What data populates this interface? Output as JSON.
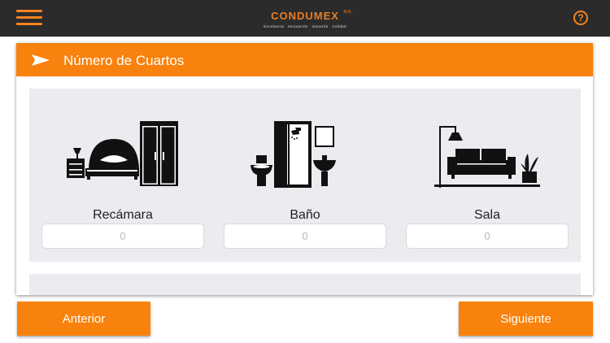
{
  "header": {
    "logo_title": "CONDUMEX",
    "logo_mark": "M.R.",
    "logo_tagline": "Excelencia · Innovación · Garantía · Calidad",
    "help_symbol": "?",
    "menu_icon": "hamburger-menu-icon",
    "help_icon": "question-circle-icon"
  },
  "card": {
    "title": "Número de Cuartos",
    "header_icon": "arrow-right-icon"
  },
  "rooms": [
    {
      "label": "Recámara",
      "placeholder": "0",
      "icon": "bedroom-icon"
    },
    {
      "label": "Baño",
      "placeholder": "0",
      "icon": "bathroom-icon"
    },
    {
      "label": "Sala",
      "placeholder": "0",
      "icon": "living-room-icon"
    }
  ],
  "buttons": {
    "prev_label": "Anterior",
    "next_label": "Siguiente"
  },
  "colors": {
    "accent": "#f8820d",
    "topbar": "#2b2b2b",
    "panel": "#ebebf0"
  }
}
